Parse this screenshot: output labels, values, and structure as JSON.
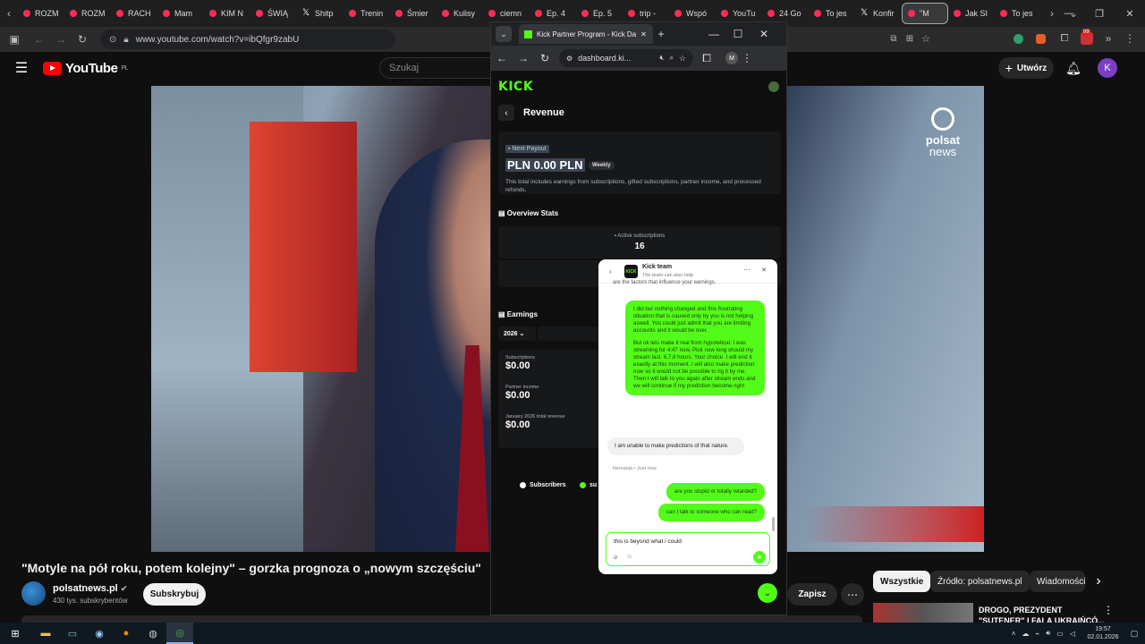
{
  "browser": {
    "tabs": [
      {
        "label": "ROZM",
        "fav": "youtube"
      },
      {
        "label": "ROZM",
        "fav": "youtube"
      },
      {
        "label": "RACH",
        "fav": "youtube"
      },
      {
        "label": "Mam",
        "fav": "youtube"
      },
      {
        "label": "KIM N",
        "fav": "youtube"
      },
      {
        "label": "ŚWIĄ",
        "fav": "youtube"
      },
      {
        "label": "Shitp",
        "fav": "x"
      },
      {
        "label": "Trenin",
        "fav": "youtube"
      },
      {
        "label": "Śmier",
        "fav": "youtube"
      },
      {
        "label": "Kulisy",
        "fav": "youtube"
      },
      {
        "label": "ciemn",
        "fav": "youtube"
      },
      {
        "label": "Ep. 4",
        "fav": "youtube"
      },
      {
        "label": "Ep. 5",
        "fav": "youtube"
      },
      {
        "label": "trip -",
        "fav": "youtube"
      },
      {
        "label": "Wspó",
        "fav": "youtube"
      },
      {
        "label": "YouTu",
        "fav": "youtube"
      },
      {
        "label": "24 Go",
        "fav": "youtube"
      },
      {
        "label": "To jes",
        "fav": "youtube"
      },
      {
        "label": "Konfir",
        "fav": "x"
      },
      {
        "label": "\"M",
        "fav": "youtube",
        "active": true
      },
      {
        "label": "Jak SI",
        "fav": "youtube"
      },
      {
        "label": "To jes",
        "fav": "youtube"
      }
    ],
    "url": "www.youtube.com/watch?v=ibQfgr9zabU",
    "ext_badge": "99"
  },
  "youtube": {
    "logo": "YouTube",
    "region": "PL",
    "search_placeholder": "Szukaj",
    "create_label": "Utwórz",
    "avatar_letter": "K",
    "video_overlay_logo": [
      "polsat",
      "news"
    ],
    "video_title": "\"Motyle na pół roku, potem kolejny\" – gorzka prognoza o „nowym szczęściu\"",
    "channel_name": "polsatnews.pl",
    "subscribers": "430 tys. subskrybentów",
    "subscribe_label": "Subskrybuj",
    "save_label": "Zapisz",
    "chips": [
      "Wszystkie",
      "Źródło: polsatnews.pl",
      "Wiadomości"
    ],
    "related_title_1": "DROGO, PREZYDENT",
    "related_title_2": "\"SUTENER\" I FALA UKRAIŃCÓ..."
  },
  "popup": {
    "tab_title": "Kick Partner Program - Kick Da",
    "url": "dashboard.ki...",
    "profile_letter": "M",
    "brand": "KICK",
    "page_title": "Revenue",
    "next_payout_label": "Next Payout",
    "next_payout_value": "PLN 0.00 PLN",
    "payout_badge": "Weekly",
    "payout_note": "This total includes earnings from subscriptions, gifted subscriptions, partner income, and processed refunds.",
    "overview_title": "Overview Stats",
    "active_subs_label": "Active subscriptions",
    "active_subs_value": "16",
    "earnings_title": "Earnings",
    "year": "2026",
    "subscriptions_label": "Subscriptions",
    "subscriptions_value": "$0.00",
    "partner_income_label": "Partner income",
    "partner_income_value": "$0.00",
    "total_revenue_label": "January 2026 total revenue",
    "total_revenue_value": "$0.00",
    "legend_subscribers": "Subscribers",
    "legend_other": "su"
  },
  "chat": {
    "title": "Kick team",
    "subtitle": "The team can also help",
    "cut_message": "are the factors that influence your earnings.",
    "user_msg_1a": "I did but nothing changed and this frustrating situation that is caused only by you is not helping aswell. You could just admit that you are limiting accounts and it would be over.",
    "user_msg_1b": "But ok lets make it real from hypotetical. I was streaming for 4:47 now. Pick now long should my stream last. 6,7,8 hours. Your choice. I will end it exactly at this moment. I will also make prediction now so it would not be possible to rig it by me. Then I will talk to you again after stream ends and we will continue if my prediction become right",
    "agent_msg": "I am unable to make predictions of that nature.",
    "agent_meta": "Nemanja • Just now",
    "user_msg_2": "are you stupid or totally retarded?",
    "user_msg_3": "can I talk to someone who can read?",
    "input_value": "this is beyond what i could"
  },
  "taskbar": {
    "time": "19:57",
    "date": "02.01.2026"
  },
  "colors": {
    "kick_green": "#53fc18",
    "youtube_red": "#ff0000",
    "tab_red": "#ff2d55"
  }
}
